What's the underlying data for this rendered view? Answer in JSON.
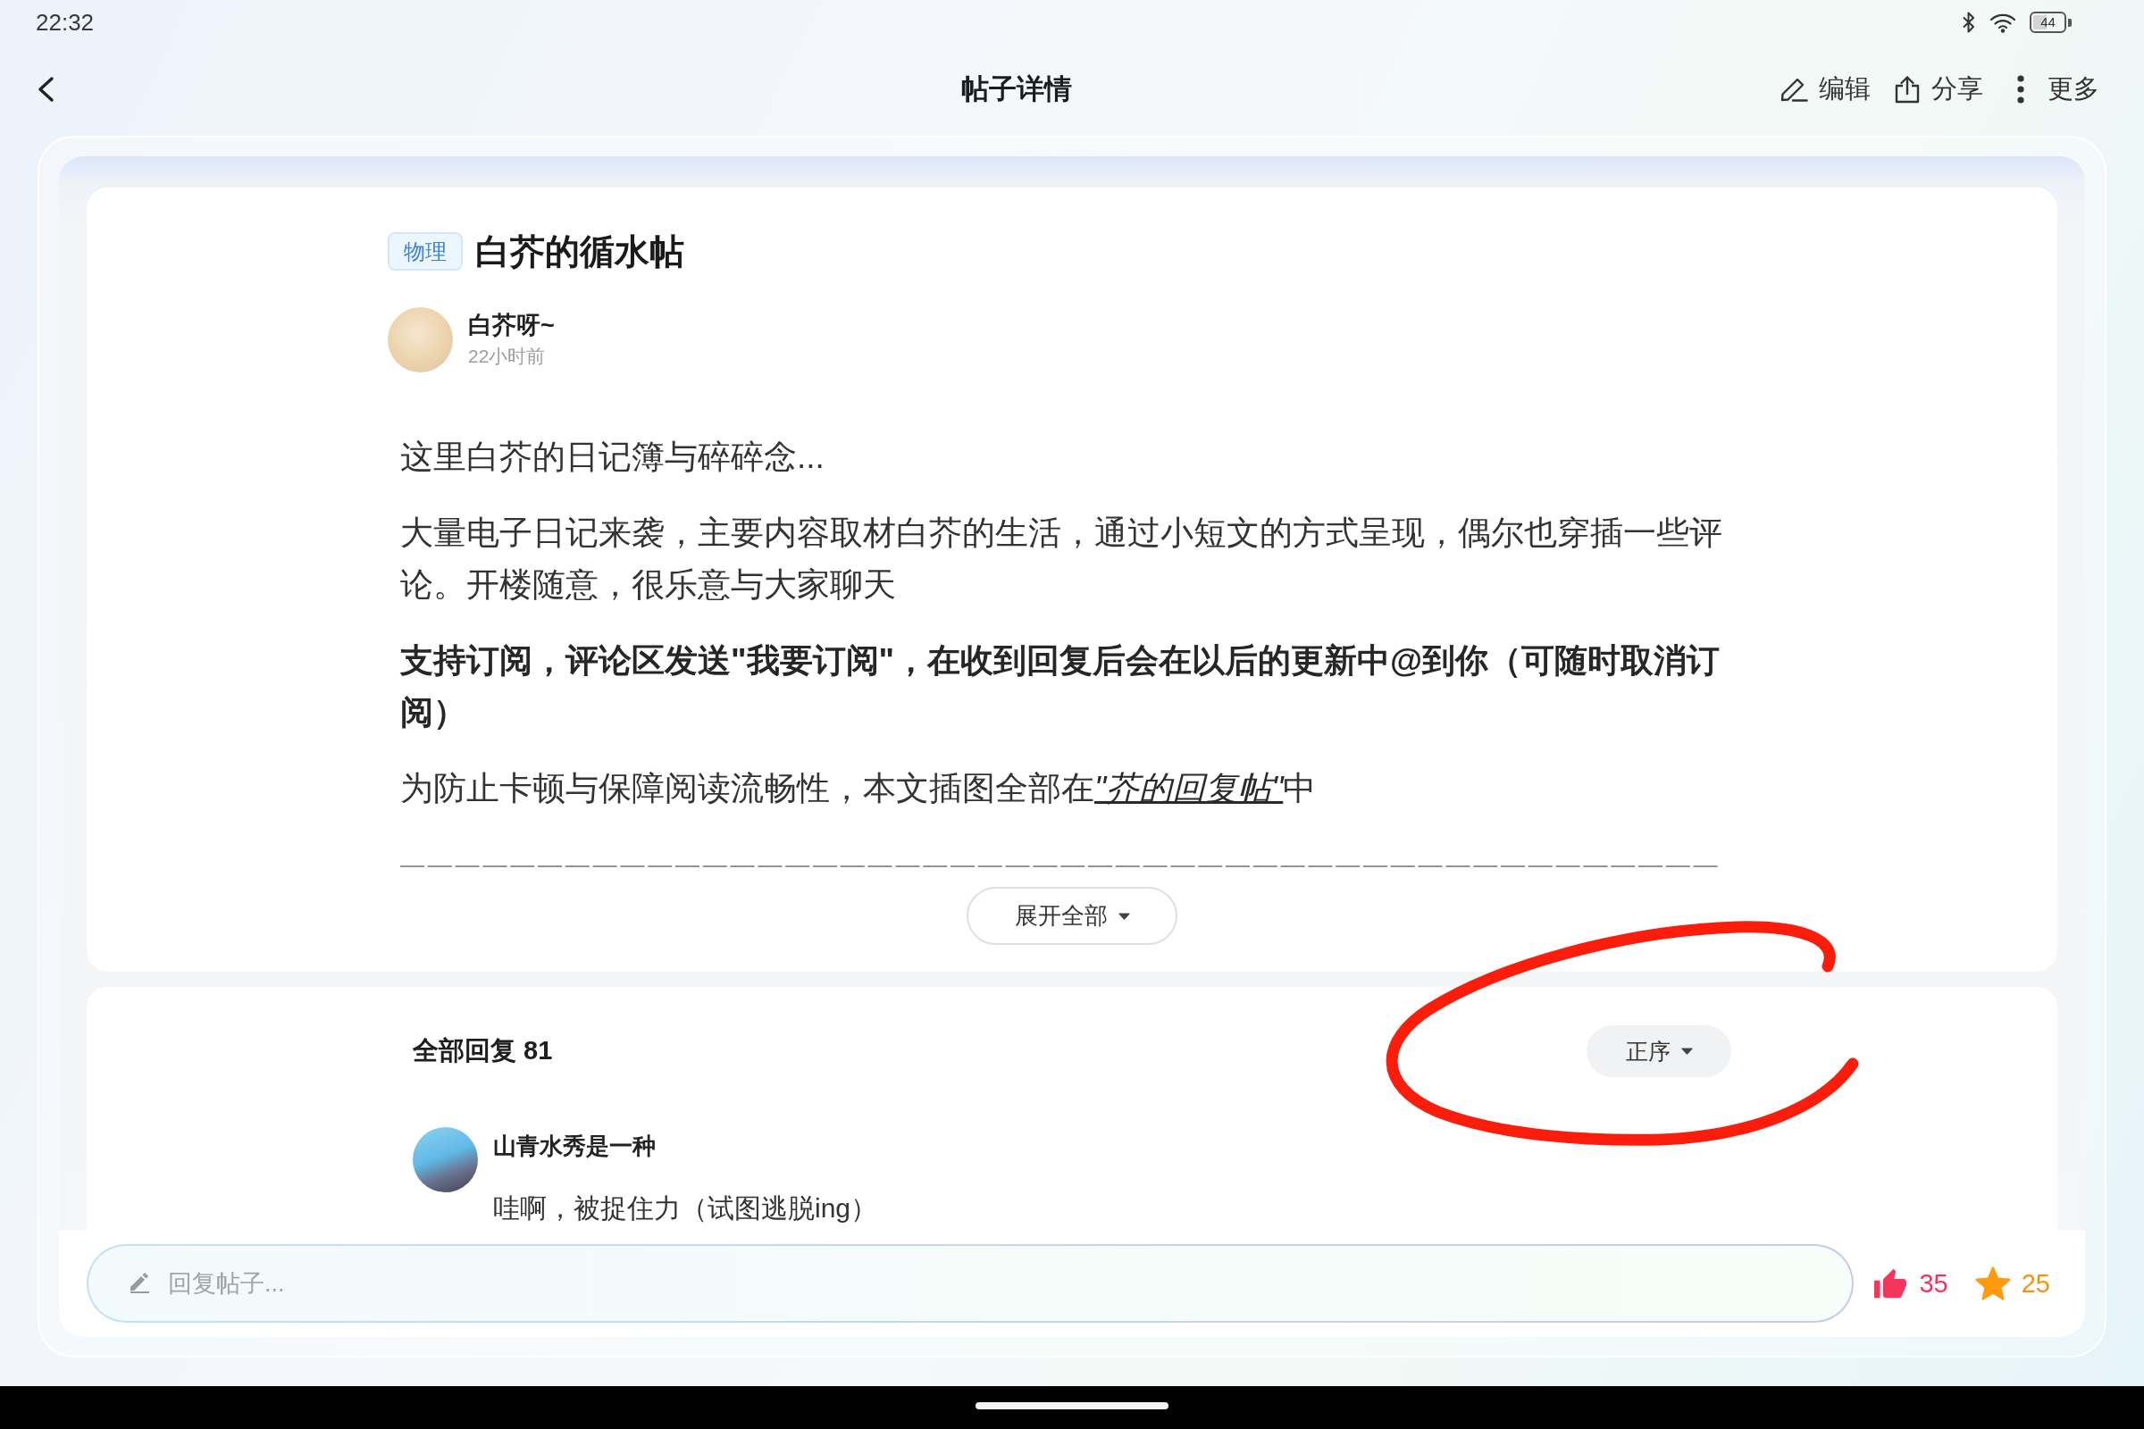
{
  "status_bar": {
    "time": "22:32",
    "battery": "44"
  },
  "nav_bar": {
    "title": "帖子详情",
    "actions": [
      {
        "kind": "edit",
        "label": "编辑"
      },
      {
        "kind": "share",
        "label": "分享"
      },
      {
        "kind": "more",
        "label": "更多"
      }
    ]
  },
  "post": {
    "tag": "物理",
    "title": "白芥的循水帖",
    "author": {
      "name": "白芥呀~",
      "time": "22小时前"
    },
    "paragraphs": [
      {
        "kind": "plain",
        "text": "这里白芥的日记簿与碎碎念..."
      },
      {
        "kind": "plain",
        "text": "大量电子日记来袭，主要内容取材白芥的生活，通过小短文的方式呈现，偶尔也穿插一些评论。开楼随意，很乐意与大家聊天"
      },
      {
        "kind": "bold",
        "text": "支持订阅，评论区发送\"我要订阅\"，在收到回复后会在以后的更新中@到你（可随时取消订阅）"
      },
      {
        "kind": "link",
        "text": "为防止卡顿与保障阅读流畅性，本文插图全部在",
        "link": "\"芥的回复帖\"",
        "after": "中"
      },
      {
        "kind": "divider",
        "text": "————————————————————————————————————————————————"
      }
    ],
    "expand_label": "展开全部"
  },
  "replies": {
    "heading": "全部回复 81",
    "sort_label": "正序",
    "items": [
      {
        "name": "山青水秀是一种",
        "text": "哇啊，被捉住力（试图逃脱ing）"
      }
    ]
  },
  "reply_bar": {
    "placeholder": "回复帖子...",
    "likes": "35",
    "favorites": "25"
  }
}
